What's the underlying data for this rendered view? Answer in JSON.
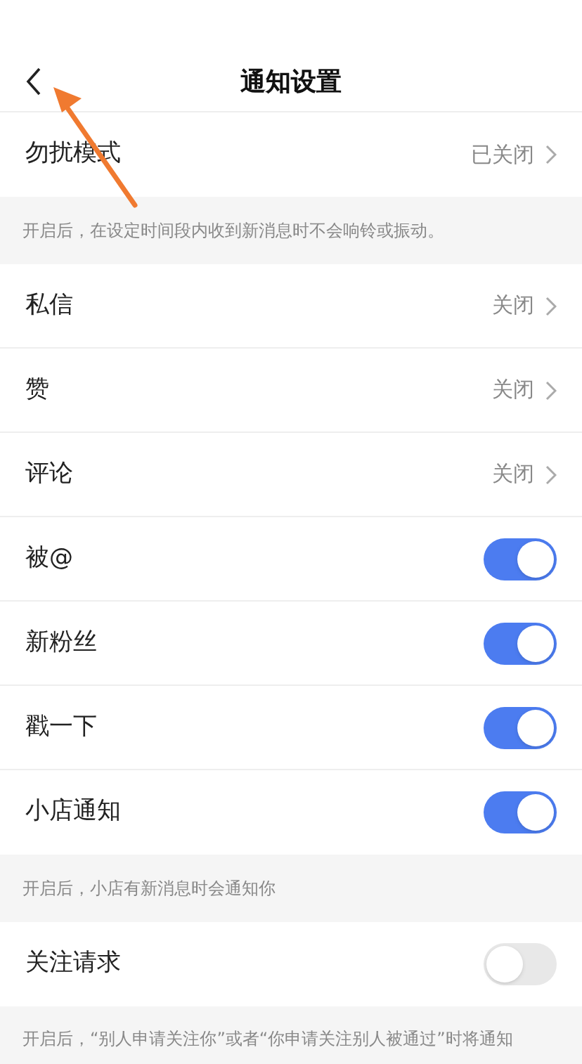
{
  "header": {
    "title": "通知设置"
  },
  "sections": [
    {
      "rows": [
        {
          "kind": "link",
          "label": "勿扰模式",
          "value": "已关闭"
        }
      ],
      "note": "开启后，在设定时间段内收到新消息时不会响铃或振动。"
    },
    {
      "rows": [
        {
          "kind": "link",
          "label": "私信",
          "value": "关闭"
        },
        {
          "kind": "link",
          "label": "赞",
          "value": "关闭"
        },
        {
          "kind": "link",
          "label": "评论",
          "value": "关闭"
        },
        {
          "kind": "toggle",
          "label": "被@",
          "on": true
        },
        {
          "kind": "toggle",
          "label": "新粉丝",
          "on": true
        },
        {
          "kind": "toggle",
          "label": "戳一下",
          "on": true
        },
        {
          "kind": "toggle",
          "label": "小店通知",
          "on": true
        }
      ],
      "note": "开启后，小店有新消息时会通知你"
    },
    {
      "rows": [
        {
          "kind": "toggle",
          "label": "关注请求",
          "on": false
        }
      ],
      "note": "开启后，“别人申请关注你”或者“你申请关注别人被通过”时将通知"
    }
  ]
}
